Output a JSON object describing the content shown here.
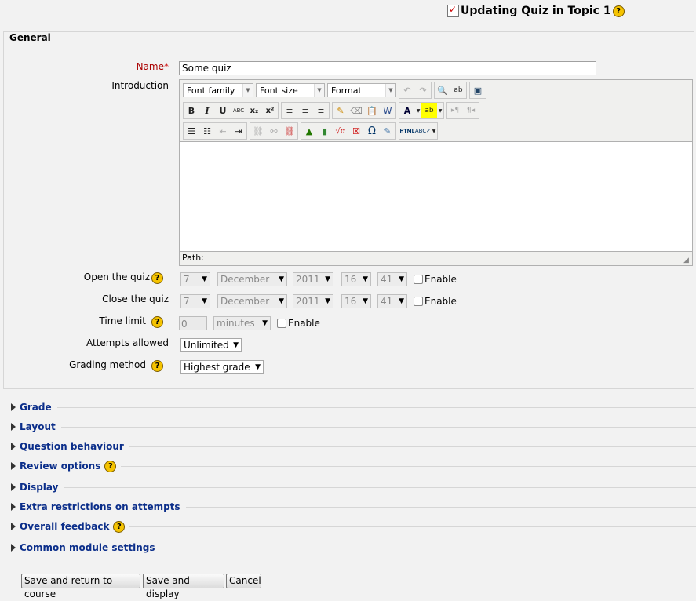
{
  "page": {
    "title": "Updating Quiz in Topic 1",
    "help": "?"
  },
  "general": {
    "legend": "General",
    "name_label": "Name",
    "required_mark": "*",
    "name_value": "Some quiz",
    "intro_label": "Introduction"
  },
  "editor": {
    "font_family": "Font family",
    "font_size": "Font size",
    "format": "Format",
    "path_label": "Path:",
    "buttons_row2": [
      "B",
      "I",
      "U",
      "ABC",
      "x₂",
      "x²"
    ],
    "omega": "Ω"
  },
  "open_quiz": {
    "label": "Open the quiz",
    "day": "7",
    "month": "December",
    "year": "2011",
    "hour": "16",
    "minute": "41",
    "enable": "Enable"
  },
  "close_quiz": {
    "label": "Close the quiz",
    "day": "7",
    "month": "December",
    "year": "2011",
    "hour": "16",
    "minute": "41",
    "enable": "Enable"
  },
  "time_limit": {
    "label": "Time limit",
    "value": "0",
    "unit": "minutes",
    "enable": "Enable"
  },
  "attempts": {
    "label": "Attempts allowed",
    "value": "Unlimited"
  },
  "grading": {
    "label": "Grading method",
    "value": "Highest grade"
  },
  "sections": [
    {
      "title": "Grade"
    },
    {
      "title": "Layout"
    },
    {
      "title": "Question behaviour"
    },
    {
      "title": "Review options"
    },
    {
      "title": "Display"
    },
    {
      "title": "Extra restrictions on attempts"
    },
    {
      "title": "Overall feedback"
    },
    {
      "title": "Common module settings"
    }
  ],
  "actions": {
    "save_return": "Save and return to course",
    "save_display": "Save and display",
    "cancel": "Cancel"
  }
}
